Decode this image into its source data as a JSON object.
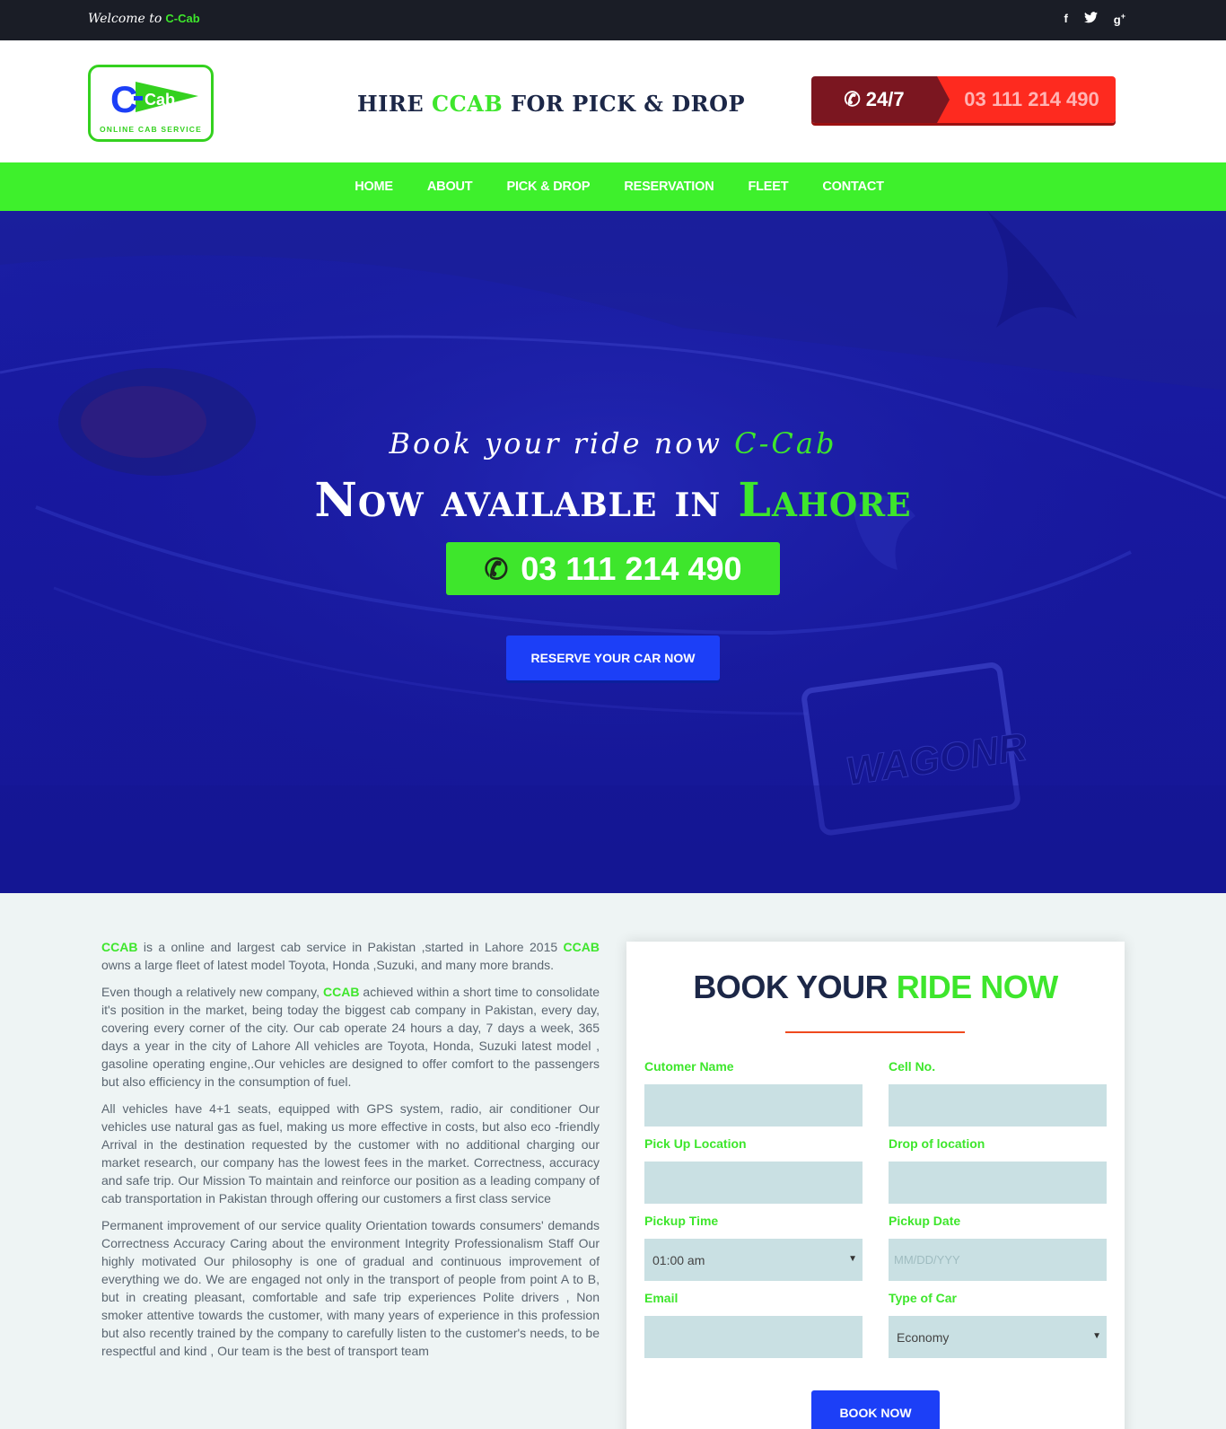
{
  "topbar": {
    "welcome": "Welcome to",
    "brand": "C-Cab",
    "social": [
      {
        "icon": "facebook-icon",
        "glyph": "f"
      },
      {
        "icon": "twitter-icon",
        "glyph": "🐦"
      },
      {
        "icon": "google-plus-icon",
        "glyph": "g+"
      }
    ]
  },
  "header": {
    "logo_text": "Cab",
    "logo_letter": "C",
    "logo_tagline": "Online cab service",
    "tagline_pre": "HIRE ",
    "tagline_brand": "CCAB",
    "tagline_post": " FOR PICK & DROP",
    "hours": "24/7",
    "phone": "03 111 214 490"
  },
  "nav": {
    "items": [
      "HOME",
      "ABOUT",
      "PICK & DROP",
      "RESERVATION",
      "FLEET",
      "CONTACT"
    ]
  },
  "hero": {
    "script_pre": "Book your ride now ",
    "script_brand": "C-Cab",
    "title_pre": "Now available in ",
    "title_city": "Lahore",
    "phone": "03 111 214 490",
    "reserve_label": "RESERVE YOUR CAR NOW"
  },
  "about": {
    "p1_brand": "CCAB",
    "p1_a": " is a online and largest cab service in Pakistan ,started in Lahore 2015 ",
    "p1_brand2": "CCAB",
    "p1_b": " owns a large fleet of latest model Toyota, Honda ,Suzuki, and many more brands.",
    "p2_a": "Even though a relatively new company, ",
    "p2_brand": "CCAB",
    "p2_b": " achieved within a short time to consolidate it's position in the market, being today the biggest cab company in Pakistan, every day, covering every corner of the city. Our cab operate 24 hours a day, 7 days a week, 365 days a year in the city of Lahore All vehicles are Toyota, Honda, Suzuki latest model , gasoline operating engine,.Our vehicles are designed to offer comfort to the passengers but also efficiency in the consumption of fuel.",
    "p3": "All vehicles have 4+1 seats, equipped with GPS system, radio, air conditioner Our vehicles use natural gas as fuel, making us more effective in costs, but also eco -friendly Arrival in the destination requested by the customer with no additional charging our market research, our company has the lowest fees in the market. Correctness, accuracy and safe trip. Our Mission To maintain and reinforce our position as a leading company of cab transportation in Pakistan through offering our customers a first class service",
    "p4": "Permanent improvement of our service quality Orientation towards consumers' demands Correctness Accuracy Caring about the environment Integrity Professionalism Staff Our highly motivated Our philosophy is one of gradual and continuous improvement of everything we do. We are engaged not only in the transport of people from point A to B, but in creating pleasant, comfortable and safe trip experiences Polite drivers , Non smoker attentive towards the customer, with many years of experience in this profession but also recently trained by the company to carefully listen to the customer's needs, to be respectful and kind , Our team is the best of transport team"
  },
  "form": {
    "title_pre": "BOOK YOUR ",
    "title_green": "RIDE NOW",
    "name_label": "Cutomer Name",
    "cell_label": "Cell No.",
    "pickup_label": "Pick Up Location",
    "drop_label": "Drop of location",
    "time_label": "Pickup Time",
    "time_value": "01:00 am",
    "date_label": "Pickup Date",
    "date_placeholder": "MM/DD/YYY",
    "email_label": "Email",
    "car_label": "Type of Car",
    "car_value": "Economy",
    "book_label": "BOOK NOW"
  },
  "colors": {
    "accent_green": "#3ee62c",
    "brand_blue": "#1c3ff7",
    "navy": "#1c2747",
    "red": "#fe2a1f"
  }
}
